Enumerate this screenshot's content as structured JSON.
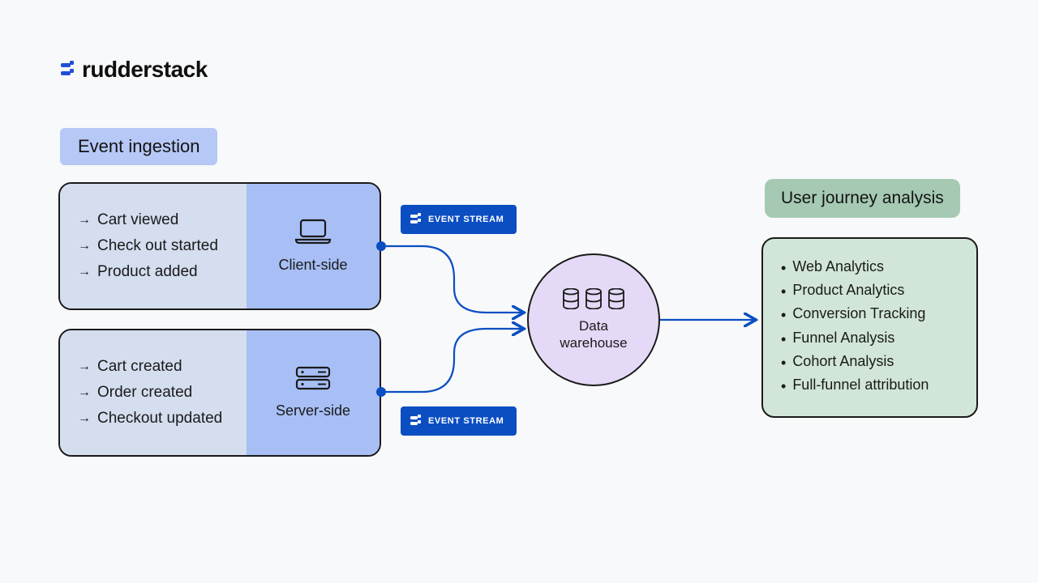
{
  "brand": {
    "name": "rudderstack"
  },
  "ingestion": {
    "title": "Event ingestion",
    "client": {
      "side_label": "Client-side",
      "events": [
        "Cart viewed",
        "Check out started",
        "Product added"
      ]
    },
    "server": {
      "side_label": "Server-side",
      "events": [
        "Cart created",
        "Order created",
        "Checkout updated"
      ]
    }
  },
  "stream_badge": "EVENT STREAM",
  "warehouse": {
    "label": "Data warehouse"
  },
  "analysis": {
    "title": "User journey analysis",
    "items": [
      "Web Analytics",
      "Product Analytics",
      "Conversion Tracking",
      "Funnel Analysis",
      "Cohort Analysis",
      "Full-funnel attribution"
    ]
  }
}
